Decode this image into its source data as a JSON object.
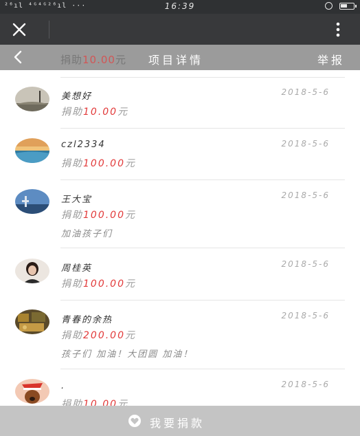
{
  "status_bar": {
    "signal_text": "²⁶ıl ⁴ᴳ⁴ᴳ²⁶ıl ···",
    "time": "16:39",
    "icons": [
      "alarm-icon",
      "battery-icon"
    ]
  },
  "top_bar": {
    "close_icon": "close-icon",
    "more_icon": "more-vertical-icon"
  },
  "page_header": {
    "behind_prefix": "捐助",
    "behind_amount": "10.00",
    "behind_suffix": "元",
    "title": "项目详情",
    "report_label": "举报"
  },
  "donations": [
    {
      "name": "美想好",
      "date": "2018-5-6",
      "amount_prefix": "捐助",
      "amount": "10.00",
      "amount_suffix": "元",
      "message": ""
    },
    {
      "name": "czl2334",
      "date": "2018-5-6",
      "amount_prefix": "捐助",
      "amount": "100.00",
      "amount_suffix": "元",
      "message": ""
    },
    {
      "name": "王大宝",
      "date": "2018-5-6",
      "amount_prefix": "捐助",
      "amount": "100.00",
      "amount_suffix": "元",
      "message": "加油孩子们"
    },
    {
      "name": "周桂英",
      "date": "2018-5-6",
      "amount_prefix": "捐助",
      "amount": "100.00",
      "amount_suffix": "元",
      "message": ""
    },
    {
      "name": "青春的余热",
      "date": "2018-5-6",
      "amount_prefix": "捐助",
      "amount": "200.00",
      "amount_suffix": "元",
      "message": "孩子们 加油！大团圆 加油！"
    },
    {
      "name": ".",
      "date": "2018-5-6",
      "amount_prefix": "捐助",
      "amount": "10.00",
      "amount_suffix": "元",
      "message": ""
    }
  ],
  "donate_bar": {
    "label": "我要捐款",
    "icon": "heart-icon"
  },
  "colors": {
    "status_bar_bg": "#2f3133",
    "top_bar_bg": "#38393b",
    "header_bg": "#9b9b9b",
    "amount_red": "#e23a3a",
    "donate_bar_bg": "#c4c4c4"
  }
}
